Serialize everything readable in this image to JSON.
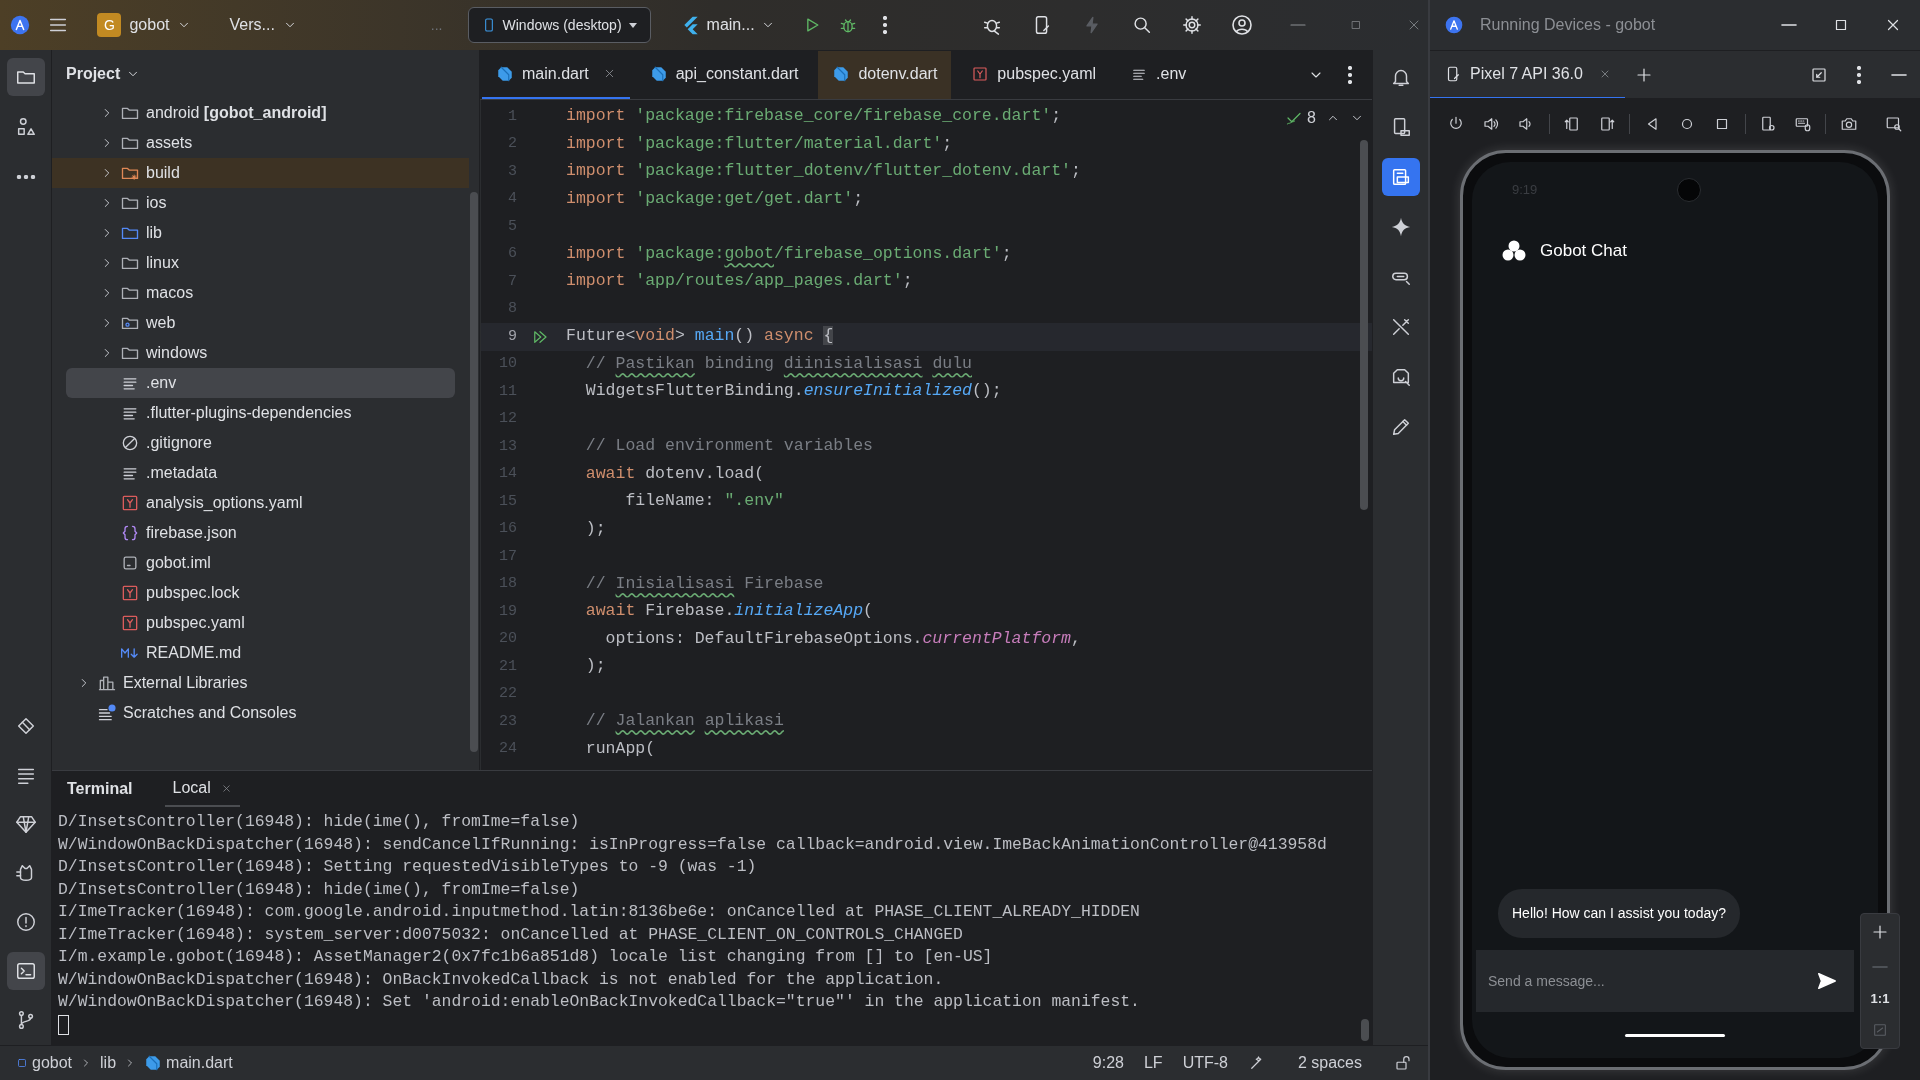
{
  "toolbar": {
    "project_badge": "G",
    "project": "gobot",
    "vcs": "Vers...",
    "overflow": "...",
    "device": "Windows (desktop)",
    "run_config": "main..."
  },
  "left_stripe": {
    "top": [
      {
        "kind": "project",
        "selected": true
      },
      {
        "kind": "structure",
        "selected": false
      },
      {
        "kind": "more",
        "selected": false
      }
    ],
    "bottom": [
      {
        "kind": "bookmarks",
        "selected": false
      },
      {
        "kind": "todo",
        "selected": false
      },
      {
        "kind": "gem",
        "selected": false
      },
      {
        "kind": "logcat",
        "selected": false
      },
      {
        "kind": "problems",
        "selected": false
      },
      {
        "kind": "terminal",
        "selected": true
      },
      {
        "kind": "git",
        "selected": false
      }
    ]
  },
  "project_panel": {
    "title": "Project",
    "tree": [
      {
        "children": [
          {
            "label": "android **[gobot_android]**",
            "kind": "folder",
            "expandable": true,
            "selected": false
          },
          {
            "label": "assets",
            "kind": "folder",
            "expandable": true,
            "selected": false
          },
          {
            "label": "build",
            "kind": "excluded",
            "expandable": true,
            "selected": false
          },
          {
            "label": "ios",
            "kind": "folder",
            "expandable": true,
            "selected": false
          },
          {
            "label": "lib",
            "kind": "source",
            "expandable": true,
            "selected": false
          },
          {
            "label": "linux",
            "kind": "folder",
            "expandable": true,
            "selected": false
          },
          {
            "label": "macos",
            "kind": "folder",
            "expandable": true,
            "selected": false
          },
          {
            "label": "web",
            "kind": "web",
            "expandable": true,
            "selected": false
          },
          {
            "label": "windows",
            "kind": "folder",
            "expandable": true,
            "selected": false
          },
          {
            "label": ".env",
            "kind": "text",
            "expandable": false,
            "selected": true
          },
          {
            "label": ".flutter-plugins-dependencies",
            "kind": "text",
            "expandable": false,
            "selected": false
          },
          {
            "label": ".gitignore",
            "kind": "ignore",
            "expandable": false,
            "selected": false
          },
          {
            "label": ".metadata",
            "kind": "text",
            "expandable": false,
            "selected": false
          },
          {
            "label": "analysis_options.yaml",
            "kind": "yaml",
            "expandable": false,
            "selected": false
          },
          {
            "label": "firebase.json",
            "kind": "json",
            "expandable": false,
            "selected": false
          },
          {
            "label": "gobot.iml",
            "kind": "iml",
            "expandable": false,
            "selected": false
          },
          {
            "label": "pubspec.lock",
            "kind": "yaml",
            "expandable": false,
            "selected": false
          },
          {
            "label": "pubspec.yaml",
            "kind": "yaml",
            "expandable": false,
            "selected": false
          },
          {
            "label": "README.md",
            "kind": "markdown",
            "expandable": false,
            "selected": false
          }
        ]
      },
      {
        "label": "External Libraries",
        "kind": "libraries",
        "expandable": true,
        "selected": false
      },
      {
        "label": "Scratches and Consoles",
        "kind": "scratches",
        "expandable": false,
        "selected": false
      }
    ]
  },
  "editor": {
    "tabs": [
      {
        "label": "main.dart",
        "kind": "dart",
        "selected": true
      },
      {
        "label": "api_constant.dart",
        "kind": "dart",
        "selected": false
      },
      {
        "label": "dotenv.dart",
        "kind": "dart",
        "selected": false
      },
      {
        "label": "pubspec.yaml",
        "kind": "yaml",
        "selected": false
      },
      {
        "label": ".env",
        "kind": "text",
        "selected": false
      }
    ],
    "inspection_count": "8",
    "lines": [
      {
        "number": "1",
        "current": false,
        "tokens": [
          {
            "text": "import ",
            "kind": "keyword"
          },
          {
            "text": "'package:firebase_core/firebase_core.dart'",
            "kind": "string"
          },
          {
            "text": ";",
            "kind": "plain"
          }
        ]
      },
      {
        "number": "2",
        "current": false,
        "tokens": [
          {
            "text": "import ",
            "kind": "keyword"
          },
          {
            "text": "'package:flutter/material.dart'",
            "kind": "string"
          },
          {
            "text": ";",
            "kind": "plain"
          }
        ]
      },
      {
        "number": "3",
        "current": false,
        "tokens": [
          {
            "text": "import ",
            "kind": "keyword"
          },
          {
            "text": "'package:flutter_dotenv/flutter_dotenv.dart'",
            "kind": "string"
          },
          {
            "text": ";",
            "kind": "plain"
          }
        ]
      },
      {
        "number": "4",
        "current": false,
        "tokens": [
          {
            "text": "import ",
            "kind": "keyword"
          },
          {
            "text": "'package:get/get.dart'",
            "kind": "string"
          },
          {
            "text": ";",
            "kind": "plain"
          }
        ]
      },
      {
        "number": "5",
        "current": false
      },
      {
        "number": "6",
        "current": false,
        "tokens": [
          {
            "text": "import ",
            "kind": "keyword"
          },
          {
            "text": "'package:",
            "kind": "string"
          },
          {
            "text": "gobot",
            "kind": "string-typo"
          },
          {
            "text": "/firebase_options.dart'",
            "kind": "string"
          },
          {
            "text": ";",
            "kind": "plain"
          }
        ]
      },
      {
        "number": "7",
        "current": false,
        "tokens": [
          {
            "text": "import ",
            "kind": "keyword"
          },
          {
            "text": "'app/routes/app_pages.dart'",
            "kind": "string"
          },
          {
            "text": ";",
            "kind": "plain"
          }
        ]
      },
      {
        "number": "8",
        "current": false
      },
      {
        "number": "9",
        "current": true,
        "tokens": [
          {
            "text": "Future<",
            "kind": "plain"
          },
          {
            "text": "void",
            "kind": "keyword"
          },
          {
            "text": "> ",
            "kind": "plain"
          },
          {
            "text": "main",
            "kind": "function"
          },
          {
            "text": "() ",
            "kind": "plain"
          },
          {
            "text": "async ",
            "kind": "keyword"
          },
          {
            "text": "{",
            "kind": "brace"
          }
        ]
      },
      {
        "number": "10",
        "current": false,
        "tokens": [
          {
            "text": "  // ",
            "kind": "comment"
          },
          {
            "text": "Pastikan",
            "kind": "comment-typo"
          },
          {
            "text": " binding ",
            "kind": "comment"
          },
          {
            "text": "diinisialisasi",
            "kind": "comment-typo"
          },
          {
            "text": " dulu",
            "kind": "comment-typo"
          }
        ]
      },
      {
        "number": "11",
        "current": false,
        "tokens": [
          {
            "text": "  WidgetsFlutterBinding.",
            "kind": "plain"
          },
          {
            "text": "ensureInitialized",
            "kind": "method"
          },
          {
            "text": "();",
            "kind": "plain"
          }
        ]
      },
      {
        "number": "12",
        "current": false
      },
      {
        "number": "13",
        "current": false,
        "tokens": [
          {
            "text": "  // Load environment variables",
            "kind": "comment"
          }
        ]
      },
      {
        "number": "14",
        "current": false,
        "tokens": [
          {
            "text": "  await ",
            "kind": "keyword"
          },
          {
            "text": "dotenv.load(",
            "kind": "plain"
          }
        ]
      },
      {
        "number": "15",
        "current": false,
        "tokens": [
          {
            "text": "      fileName: ",
            "kind": "plain"
          },
          {
            "text": "\".env\"",
            "kind": "string"
          }
        ]
      },
      {
        "number": "16",
        "current": false,
        "tokens": [
          {
            "text": "  );",
            "kind": "plain"
          }
        ]
      },
      {
        "number": "17",
        "current": false
      },
      {
        "number": "18",
        "current": false,
        "tokens": [
          {
            "text": "  // ",
            "kind": "comment"
          },
          {
            "text": "Inisialisasi",
            "kind": "comment-typo"
          },
          {
            "text": " Firebase",
            "kind": "comment"
          }
        ]
      },
      {
        "number": "19",
        "current": false,
        "tokens": [
          {
            "text": "  await ",
            "kind": "keyword"
          },
          {
            "text": "Firebase.",
            "kind": "plain"
          },
          {
            "text": "initializeApp",
            "kind": "method"
          },
          {
            "text": "(",
            "kind": "plain"
          }
        ]
      },
      {
        "number": "20",
        "current": false,
        "tokens": [
          {
            "text": "    options: DefaultFirebaseOptions.",
            "kind": "plain"
          },
          {
            "text": "currentPlatform",
            "kind": "field"
          },
          {
            "text": ",",
            "kind": "plain"
          }
        ]
      },
      {
        "number": "21",
        "current": false,
        "tokens": [
          {
            "text": "  );",
            "kind": "plain"
          }
        ]
      },
      {
        "number": "22",
        "current": false
      },
      {
        "number": "23",
        "current": false,
        "tokens": [
          {
            "text": "  // ",
            "kind": "comment"
          },
          {
            "text": "Jalankan",
            "kind": "comment-typo"
          },
          {
            "text": " aplikasi",
            "kind": "comment-typo"
          }
        ]
      },
      {
        "number": "24",
        "current": false,
        "tokens": [
          {
            "text": "  runApp(",
            "kind": "plain"
          }
        ]
      }
    ]
  },
  "right_stripe": [
    {
      "kind": "notifications",
      "selected": false
    },
    {
      "kind": "device-manager",
      "selected": false
    },
    {
      "kind": "running-devices",
      "selected": true
    },
    {
      "kind": "gemini",
      "selected": false
    },
    {
      "kind": "link",
      "selected": false
    },
    {
      "kind": "tools",
      "selected": false
    },
    {
      "kind": "inspector",
      "selected": false
    },
    {
      "kind": "pencil",
      "selected": false
    }
  ],
  "terminal": {
    "title": "Terminal",
    "tab": "Local",
    "lines": [
      "D/InsetsController(16948): hide(ime(), fromIme=false)",
      "W/WindowOnBackDispatcher(16948): sendCancelIfRunning: isInProgress=false callback=android.view.ImeBackAnimationController@413958d",
      "D/InsetsController(16948): Setting requestedVisibleTypes to -9 (was -1)",
      "D/InsetsController(16948): hide(ime(), fromIme=false)",
      "I/ImeTracker(16948): com.google.android.inputmethod.latin:8136be6e: onCancelled at PHASE_CLIENT_ALREADY_HIDDEN",
      "I/ImeTracker(16948): system_server:d0075032: onCancelled at PHASE_CLIENT_ON_CONTROLS_CHANGED",
      "I/m.example.gobot(16948): AssetManager2(0x7fc1b6a851d8) locale list changing from [] to [en-US]",
      "W/WindowOnBackDispatcher(16948): OnBackInvokedCallback is not enabled for the application.",
      "W/WindowOnBackDispatcher(16948): Set 'android:enableOnBackInvokedCallback=\"true\"' in the application manifest."
    ]
  },
  "status_bar": {
    "breadcrumbs": [
      "gobot",
      "lib",
      "main.dart"
    ],
    "position": "9:28",
    "line_separator": "LF",
    "encoding": "UTF-8",
    "indent": "2 spaces"
  },
  "device_window": {
    "title": "Running Devices - gobot",
    "tab": "Pixel 7 API 36.0",
    "phone": {
      "time": "9:19",
      "app_title": "Gobot Chat",
      "messages": [
        "Hello! How can I assist you today?"
      ],
      "input": {
        "placeholder": "Send a message..."
      }
    },
    "zoom_reset": "1:1"
  }
}
